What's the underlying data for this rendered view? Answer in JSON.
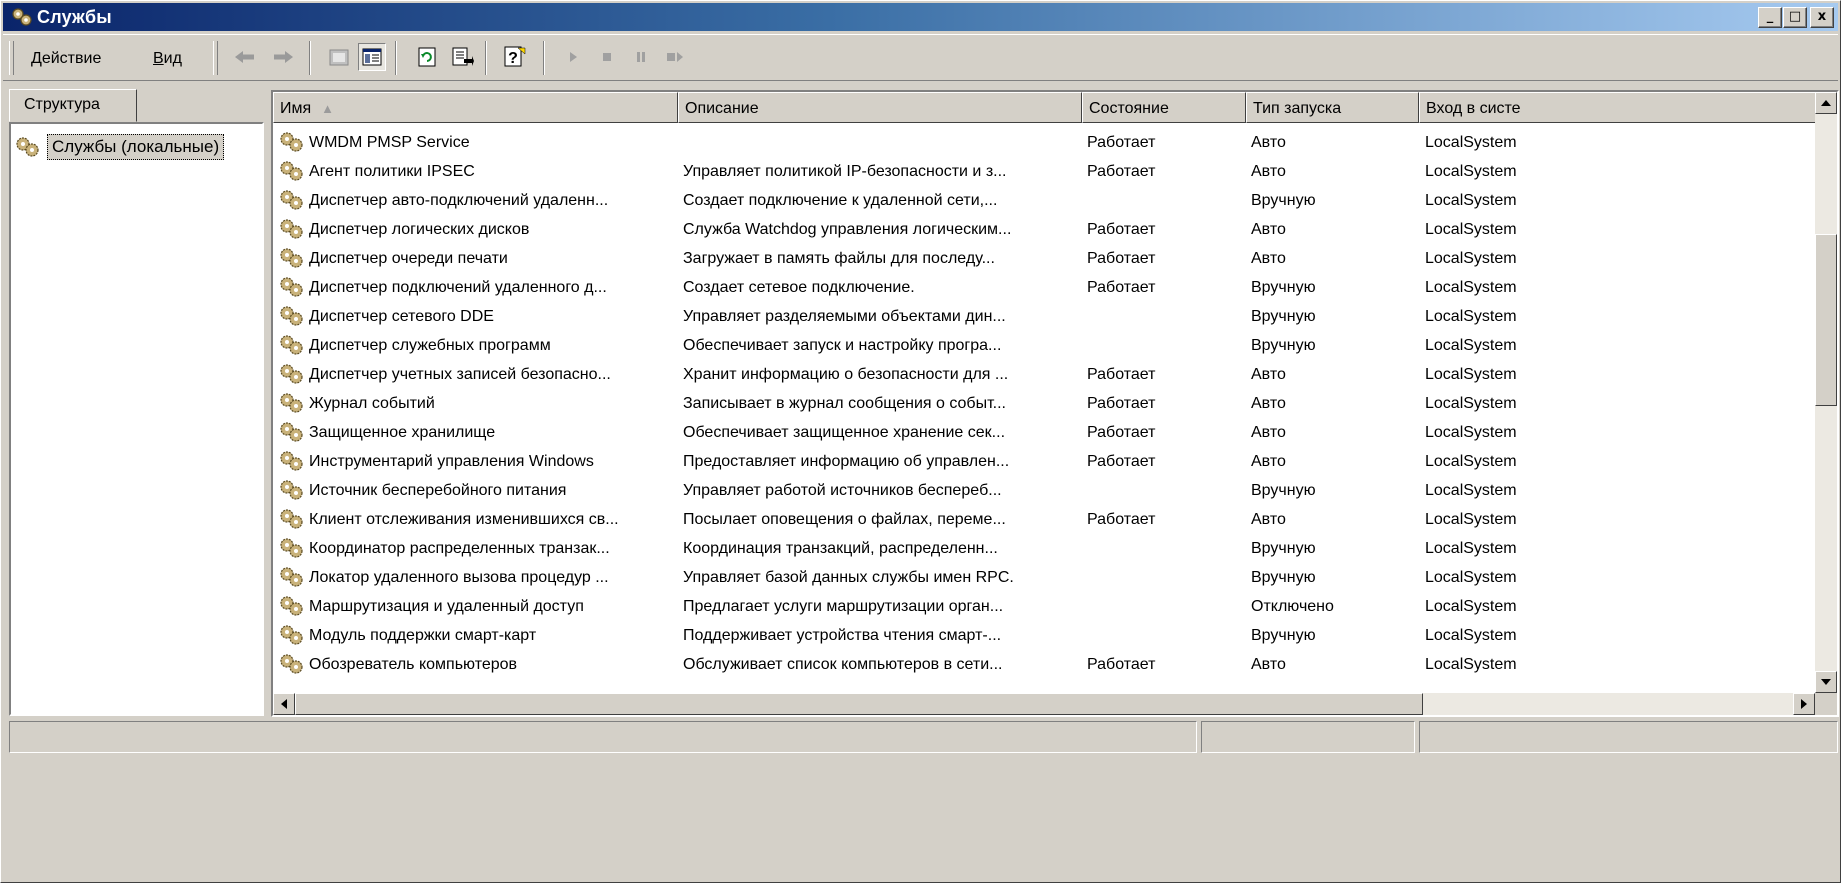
{
  "window": {
    "title": "Службы",
    "minimize_label": "_",
    "maximize_label": "□",
    "close_label": "x"
  },
  "menu": {
    "action": {
      "accel": "Д",
      "rest": "ействие"
    },
    "view": {
      "accel": "В",
      "rest": "ид"
    }
  },
  "toolbar_icons": [
    "back-icon",
    "forward-icon",
    "up-folder-icon",
    "show-hide-tree-icon",
    "refresh-icon",
    "export-list-icon",
    "help-icon",
    "start-service-icon",
    "stop-service-icon",
    "pause-service-icon",
    "restart-service-icon"
  ],
  "tree": {
    "tab_label": "Структура",
    "root_label": "Службы (локальные)"
  },
  "columns": {
    "name": "Имя",
    "sort_indicator": "▲",
    "description": "Описание",
    "state": "Состояние",
    "startup": "Тип запуска",
    "logon": "Вход в систе"
  },
  "services": [
    {
      "name": "WMDM PMSP Service",
      "description": "",
      "state": "Работает",
      "startup": "Авто",
      "logon": "LocalSystem"
    },
    {
      "name": "Агент политики IPSEC",
      "description": "Управляет политикой IP-безопасности и з...",
      "state": "Работает",
      "startup": "Авто",
      "logon": "LocalSystem"
    },
    {
      "name": "Диспетчер авто-подключений удаленн...",
      "description": "Создает подключение к удаленной сети,...",
      "state": "",
      "startup": "Вручную",
      "logon": "LocalSystem"
    },
    {
      "name": "Диспетчер логических дисков",
      "description": "Служба Watchdog управления логическим...",
      "state": "Работает",
      "startup": "Авто",
      "logon": "LocalSystem"
    },
    {
      "name": "Диспетчер очереди печати",
      "description": "Загружает в память файлы для последу...",
      "state": "Работает",
      "startup": "Авто",
      "logon": "LocalSystem"
    },
    {
      "name": "Диспетчер подключений удаленного д...",
      "description": "Создает сетевое подключение.",
      "state": "Работает",
      "startup": "Вручную",
      "logon": "LocalSystem"
    },
    {
      "name": "Диспетчер сетевого DDE",
      "description": "Управляет разделяемыми объектами дин...",
      "state": "",
      "startup": "Вручную",
      "logon": "LocalSystem"
    },
    {
      "name": "Диспетчер служебных программ",
      "description": "Обеспечивает запуск и настройку програ...",
      "state": "",
      "startup": "Вручную",
      "logon": "LocalSystem"
    },
    {
      "name": "Диспетчер учетных записей безопасно...",
      "description": "Хранит информацию о безопасности для ...",
      "state": "Работает",
      "startup": "Авто",
      "logon": "LocalSystem"
    },
    {
      "name": "Журнал событий",
      "description": "Записывает в журнал сообщения о событ...",
      "state": "Работает",
      "startup": "Авто",
      "logon": "LocalSystem"
    },
    {
      "name": "Защищенное хранилище",
      "description": "Обеспечивает защищенное хранение сек...",
      "state": "Работает",
      "startup": "Авто",
      "logon": "LocalSystem"
    },
    {
      "name": "Инструментарий управления Windows",
      "description": "Предоставляет информацию об управлен...",
      "state": "Работает",
      "startup": "Авто",
      "logon": "LocalSystem"
    },
    {
      "name": "Источник бесперебойного питания",
      "description": "Управляет работой источников бесперeб...",
      "state": "",
      "startup": "Вручную",
      "logon": "LocalSystem"
    },
    {
      "name": "Клиент отслеживания изменившихся св...",
      "description": "Посылает оповещения о файлах, переме...",
      "state": "Работает",
      "startup": "Авто",
      "logon": "LocalSystem"
    },
    {
      "name": "Координатор распределенных транзак...",
      "description": "Координация транзакций, распределенн...",
      "state": "",
      "startup": "Вручную",
      "logon": "LocalSystem"
    },
    {
      "name": "Локатор удаленного вызова процедур ...",
      "description": "Управляет базой данных службы имен RPC.",
      "state": "",
      "startup": "Вручную",
      "logon": "LocalSystem"
    },
    {
      "name": "Маршрутизация и удаленный доступ",
      "description": "Предлагает услуги маршрутизации орган...",
      "state": "",
      "startup": "Отключено",
      "logon": "LocalSystem"
    },
    {
      "name": "Модуль поддержки смарт-карт",
      "description": "Поддерживает устройства чтения смарт-...",
      "state": "",
      "startup": "Вручную",
      "logon": "LocalSystem"
    },
    {
      "name": "Обозреватель компьютеров",
      "description": "Обслуживает список компьютеров в сети...",
      "state": "Работает",
      "startup": "Авто",
      "logon": "LocalSystem"
    }
  ],
  "status_bar": {
    "left": "",
    "middle": "",
    "right": ""
  }
}
